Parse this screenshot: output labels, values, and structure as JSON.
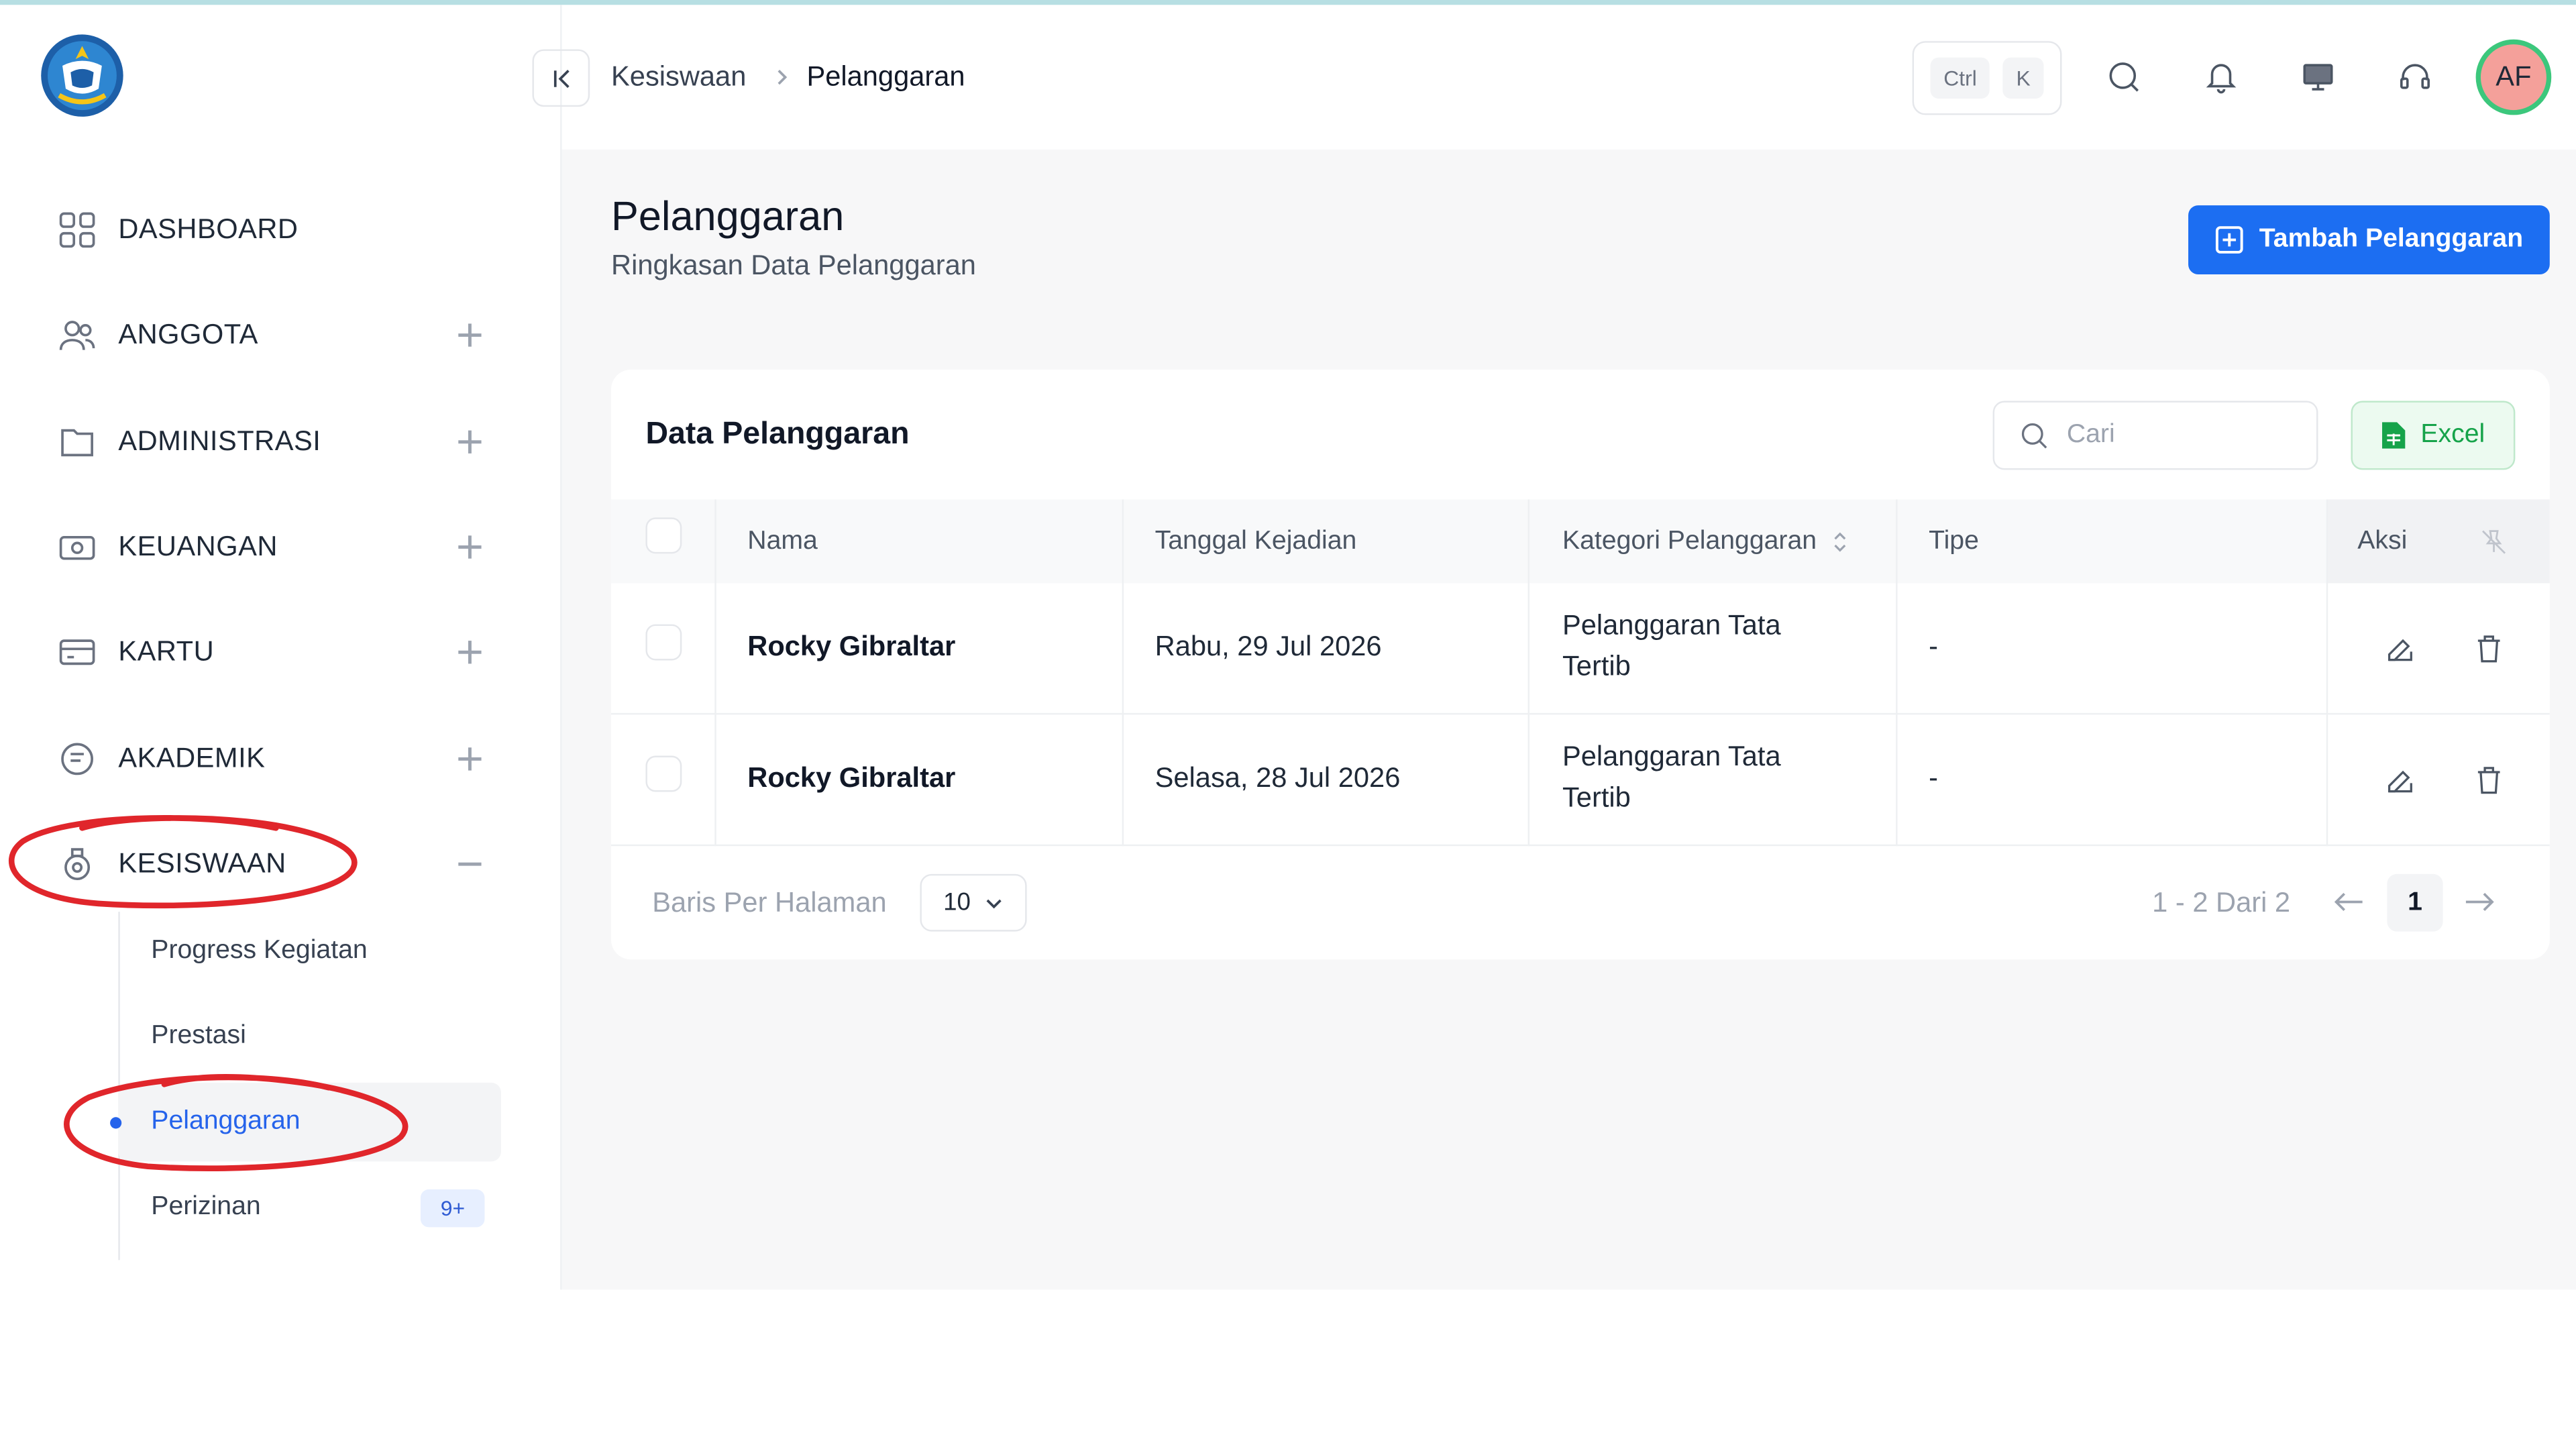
{
  "sidebar": {
    "items": [
      {
        "label": "DASHBOARD",
        "icon": "grid-icon"
      },
      {
        "label": "ANGGOTA",
        "icon": "users-icon"
      },
      {
        "label": "ADMINISTRASI",
        "icon": "folder-icon"
      },
      {
        "label": "KEUANGAN",
        "icon": "money-icon"
      },
      {
        "label": "KARTU",
        "icon": "card-icon"
      },
      {
        "label": "AKADEMIK",
        "icon": "academic-icon"
      },
      {
        "label": "KESISWAAN",
        "icon": "student-icon"
      }
    ],
    "submenu": [
      {
        "label": "Progress Kegiatan"
      },
      {
        "label": "Prestasi"
      },
      {
        "label": "Pelanggaran"
      },
      {
        "label": "Perizinan",
        "badge": "9+"
      }
    ]
  },
  "header": {
    "breadcrumb": [
      "Kesiswaan",
      "Pelanggaran"
    ],
    "shortcut_keys": [
      "Ctrl",
      "K"
    ],
    "avatar_initials": "AF"
  },
  "main": {
    "title": "Pelanggaran",
    "subtitle": "Ringkasan Data Pelanggaran",
    "add_button": "Tambah Pelanggaran"
  },
  "table": {
    "title": "Data Pelanggaran",
    "search_placeholder": "Cari",
    "export_button": "Excel",
    "columns": [
      "Nama",
      "Tanggal Kejadian",
      "Kategori Pelanggaran",
      "Tipe",
      "Aksi"
    ],
    "rows": [
      {
        "nama": "Rocky Gibraltar",
        "tanggal": "Rabu, 29 Jul 2026",
        "kategori_1": "Pelanggaran Tata",
        "kategori_2": "Tertib",
        "tipe": "-"
      },
      {
        "nama": "Rocky Gibraltar",
        "tanggal": "Selasa, 28 Jul 2026",
        "kategori_1": "Pelanggaran Tata",
        "kategori_2": "Tertib",
        "tipe": "-"
      }
    ]
  },
  "pagination": {
    "rows_per_page_label": "Baris Per Halaman",
    "rows_per_page": "10",
    "range": "1 - 2 Dari 2",
    "current_page": "1"
  },
  "colors": {
    "accent": "#1c6ef2",
    "excel_green": "#16a34a",
    "annotation_red": "#e0262b"
  }
}
